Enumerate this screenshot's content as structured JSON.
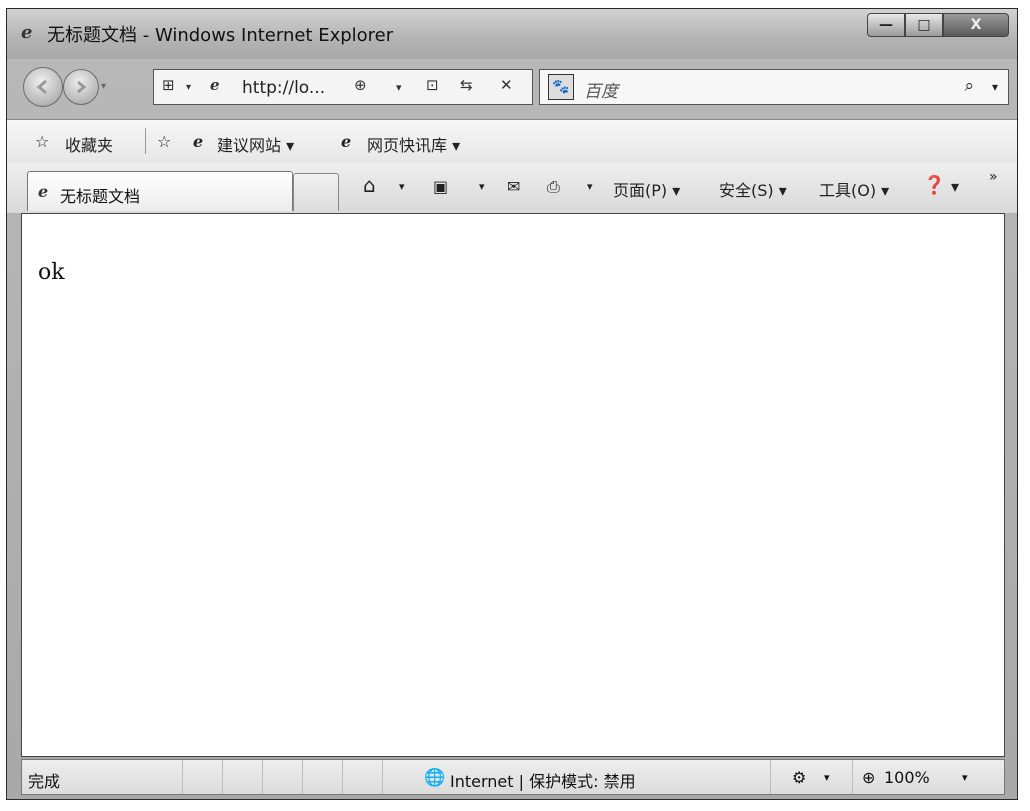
{
  "window": {
    "title": "无标题文档 - Windows Internet Explorer",
    "controls": {
      "minimize": "—",
      "maximize": "□",
      "close": "X"
    }
  },
  "navbar": {
    "address_url": "http://lo...",
    "search_placeholder": "百度",
    "search_go_glyph": "⌕",
    "dropdown_glyph": "▾"
  },
  "favorites": {
    "favorites_label": "收藏夹",
    "suggested_sites_label": "建议网站 ▾",
    "web_slice_label": "网页快讯库 ▾"
  },
  "tabs": [
    {
      "label": "无标题文档"
    }
  ],
  "commandbar": {
    "page_label": "页面(P) ▾",
    "safety_label": "安全(S) ▾",
    "tools_label": "工具(O) ▾",
    "help_label": "▾",
    "more_label": "»"
  },
  "content": {
    "text": "ok"
  },
  "status": {
    "left_text": "完成",
    "zone_text": "Internet | 保护模式: 禁用",
    "zoom_text": "100%"
  }
}
